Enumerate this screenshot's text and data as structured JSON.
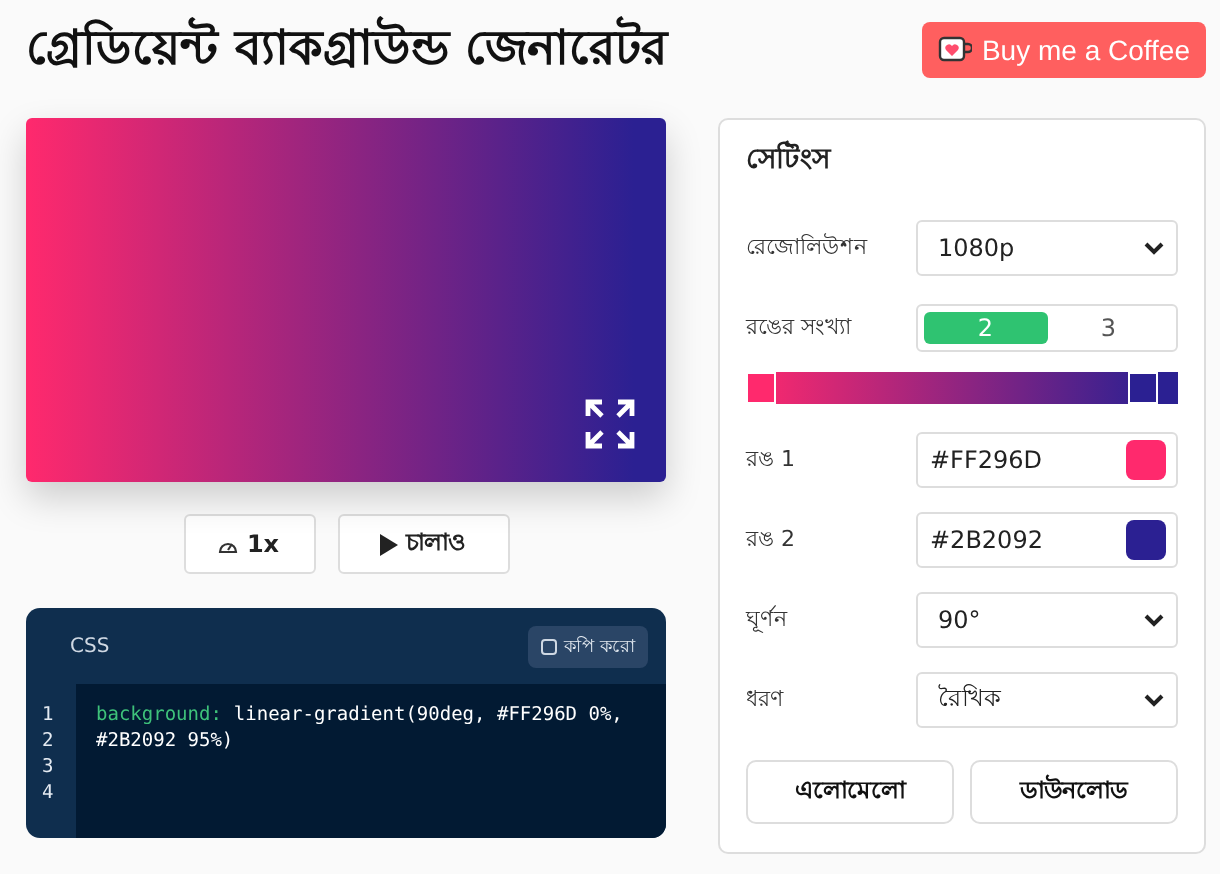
{
  "title": "গ্রেডিয়েন্ট ব্যাকগ্রাউন্ড জেনারেটর",
  "coffee_button": "Buy me a Coffee",
  "preview": {
    "stops": [
      {
        "color": "#ff296d"
      },
      {
        "color": "#2b2092"
      }
    ]
  },
  "controls": [
    {
      "kind": "speed",
      "label": "1x"
    },
    {
      "kind": "play",
      "label": "চালাও"
    }
  ],
  "code": {
    "tab": "CSS",
    "copy_button": "কপি করো",
    "lines": [
      {
        "number": "1",
        "property": "background:",
        "value": "linear-gradient(90deg, #FF296D 0%,"
      },
      {
        "number": "2",
        "value": "#2B2092 95%)"
      },
      {
        "number": "3"
      },
      {
        "number": "4"
      }
    ]
  },
  "settings": {
    "title": "সেটিংস",
    "rows": [
      {
        "kind": "select",
        "label": "রেজোলিউশন",
        "value": "1080p"
      },
      {
        "kind": "segmented",
        "label": "রঙের সংখ্যা",
        "options": [
          {
            "label": "2",
            "selected": true
          },
          {
            "label": "3",
            "selected": false
          }
        ]
      },
      {
        "kind": "gradient-bar"
      },
      {
        "kind": "color",
        "label": "রঙ 1",
        "value": "#FF296D",
        "color": "#ff296d"
      },
      {
        "kind": "color",
        "label": "রঙ 2",
        "value": "#2B2092",
        "color": "#2b2092"
      },
      {
        "kind": "select",
        "label": "ঘূর্ণন",
        "value": "90°"
      },
      {
        "kind": "select",
        "label": "ধরণ",
        "value": "রৈখিক"
      }
    ],
    "buttons": [
      "এলোমেলো",
      "ডাউনলোড"
    ]
  }
}
